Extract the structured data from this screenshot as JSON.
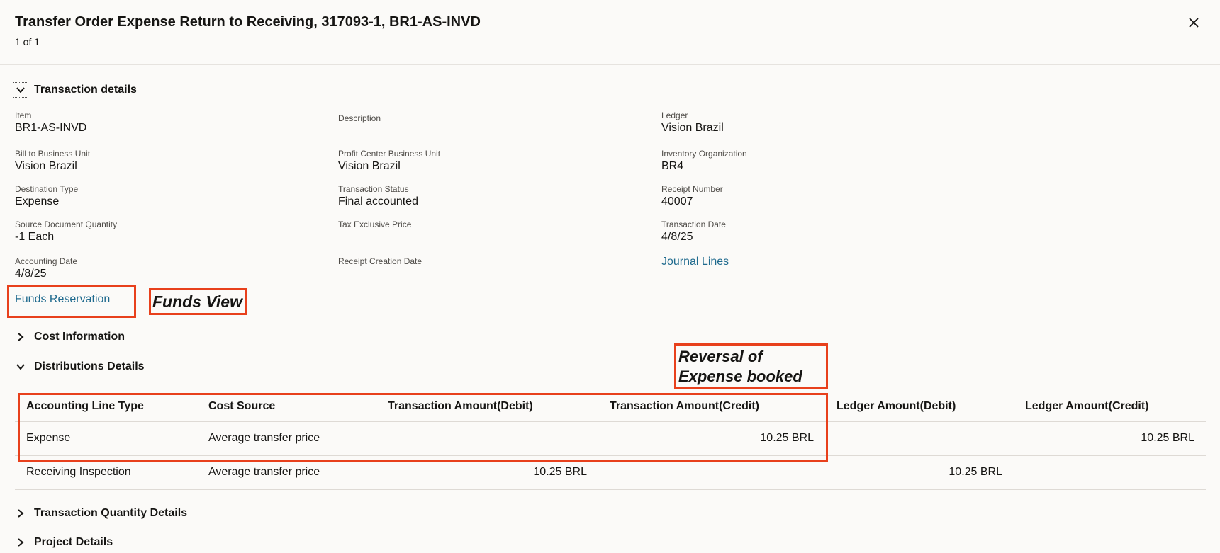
{
  "header": {
    "title": "Transfer Order Expense Return to Receiving, 317093-1, BR1-AS-INVD",
    "subtitle": "1 of 1"
  },
  "sections": {
    "transaction_details": "Transaction details",
    "cost_information": "Cost Information",
    "distributions_details": "Distributions Details",
    "transaction_quantity_details": "Transaction Quantity Details",
    "project_details": "Project Details"
  },
  "fields": {
    "item": {
      "label": "Item",
      "value": "BR1-AS-INVD"
    },
    "description": {
      "label": "Description",
      "value": ""
    },
    "ledger": {
      "label": "Ledger",
      "value": "Vision Brazil"
    },
    "bill_to_bu": {
      "label": "Bill to Business Unit",
      "value": "Vision Brazil"
    },
    "profit_center_bu": {
      "label": "Profit Center Business Unit",
      "value": "Vision Brazil"
    },
    "inventory_org": {
      "label": "Inventory Organization",
      "value": "BR4"
    },
    "destination_type": {
      "label": "Destination Type",
      "value": "Expense"
    },
    "transaction_status": {
      "label": "Transaction Status",
      "value": "Final accounted"
    },
    "receipt_number": {
      "label": "Receipt Number",
      "value": "40007"
    },
    "source_doc_qty": {
      "label": "Source Document Quantity",
      "value": "-1 Each"
    },
    "tax_exclusive_price": {
      "label": "Tax Exclusive Price",
      "value": ""
    },
    "transaction_date": {
      "label": "Transaction Date",
      "value": "4/8/25"
    },
    "accounting_date": {
      "label": "Accounting Date",
      "value": "4/8/25"
    },
    "receipt_creation_date": {
      "label": "Receipt Creation Date",
      "value": ""
    }
  },
  "links": {
    "journal_lines": "Journal Lines",
    "funds_reservation": "Funds Reservation"
  },
  "annotations": {
    "funds_view": "Funds View",
    "reversal_line1": "Reversal of",
    "reversal_line2": "Expense booked",
    "color": "#e8401c"
  },
  "distributions": {
    "columns": [
      "Accounting Line Type",
      "Cost Source",
      "Transaction Amount(Debit)",
      "Transaction Amount(Credit)",
      "Ledger Amount(Debit)",
      "Ledger Amount(Credit)"
    ],
    "rows": [
      [
        "Expense",
        "Average transfer price",
        "",
        "10.25 BRL",
        "",
        "10.25 BRL"
      ],
      [
        "Receiving Inspection",
        "Average transfer price",
        "10.25 BRL",
        "",
        "10.25 BRL",
        ""
      ]
    ]
  },
  "colors": {
    "link": "#1f6a8e",
    "background": "#fbfaf8"
  },
  "icons": {
    "close": "close-icon",
    "expanded": "chevron-down-icon",
    "collapsed": "chevron-right-icon"
  }
}
